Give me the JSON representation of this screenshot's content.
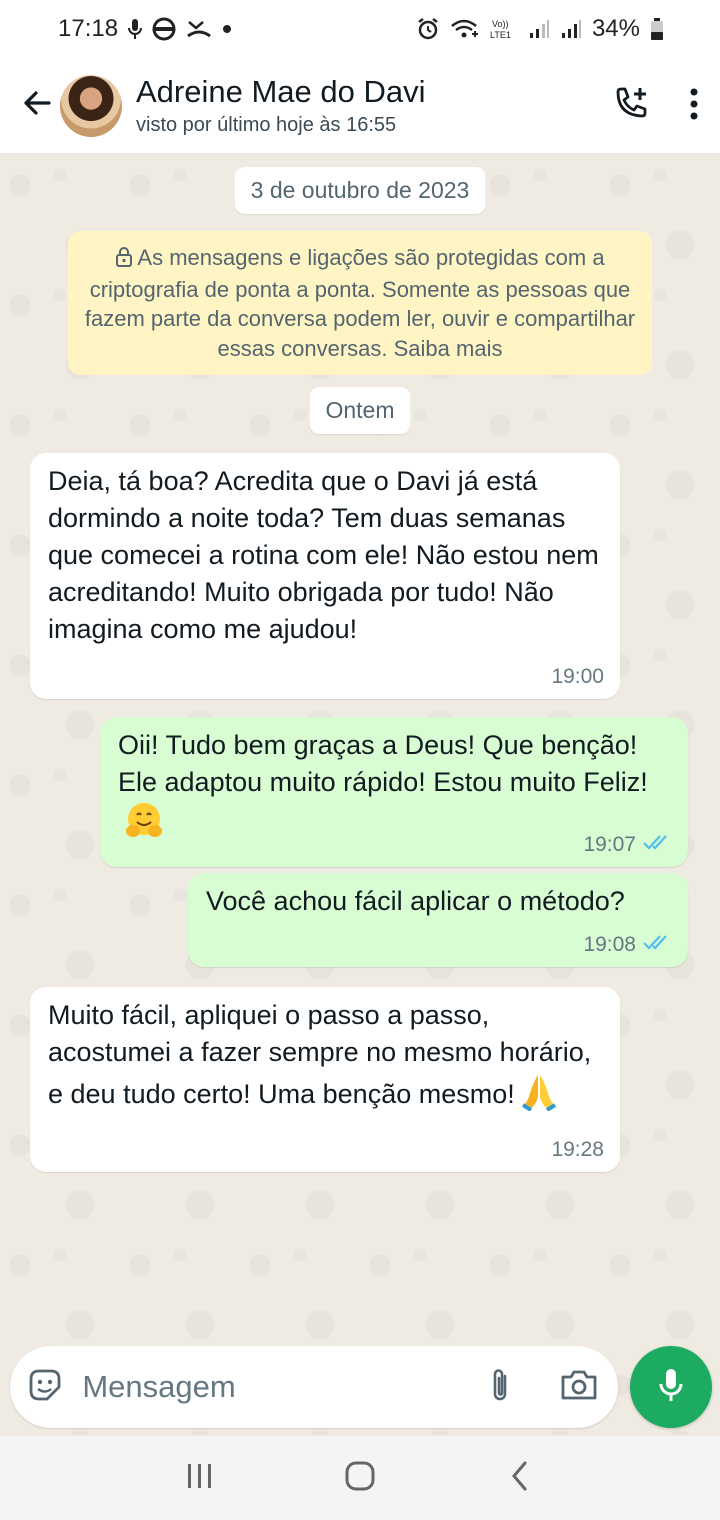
{
  "status_bar": {
    "time": "17:18",
    "battery": "34%",
    "icons": [
      "mic-icon",
      "chrome-icon",
      "missed-call-icon",
      "dot-icon",
      "alarm-icon",
      "wifi-calling-icon",
      "volte-icon",
      "signal-icon",
      "signal-icon",
      "battery-icon"
    ]
  },
  "header": {
    "contact_name": "Adreine Mae do Davi",
    "last_seen": "visto por último hoje às 16:55",
    "icons": [
      "back-arrow-icon",
      "add-call-icon",
      "more-vert-icon"
    ]
  },
  "chat": {
    "date_chip_1": "3 de outubro de 2023",
    "encryption_notice": "As mensagens e ligações são protegidas com a criptografia de ponta a ponta. Somente as pessoas que fazem parte da conversa podem ler, ouvir e compartilhar essas conversas. Saiba mais",
    "date_chip_2": "Ontem",
    "messages": [
      {
        "direction": "incoming",
        "text": "Deia, tá boa? Acredita que o Davi já está dormindo a noite toda? Tem duas semanas que comecei a rotina com ele! Não estou nem acreditando! Muito obrigada por tudo! Não imagina como me ajudou!",
        "time": "19:00"
      },
      {
        "direction": "outgoing",
        "text": "Oii! Tudo bem graças a Deus! Que benção! Ele adaptou muito rápido! Estou muito Feliz!",
        "emoji": "hugging-face-emoji",
        "time": "19:07",
        "status": "read"
      },
      {
        "direction": "outgoing",
        "text": "Você achou fácil aplicar o método?",
        "time": "19:08",
        "status": "read"
      },
      {
        "direction": "incoming",
        "text": "Muito fácil, apliquei o passo a passo, acostumei a fazer sempre no mesmo horário, e deu tudo certo! Uma benção mesmo!",
        "emoji": "folded-hands-emoji",
        "time": "19:28"
      }
    ]
  },
  "input": {
    "placeholder": "Mensagem",
    "value": ""
  },
  "colors": {
    "outgoing_bubble": "#d9fdd3",
    "incoming_bubble": "#ffffff",
    "chat_background": "#efeae2",
    "mic_button": "#1daa61",
    "read_ticks": "#53bdeb",
    "encryption_bg": "#fff5c4"
  }
}
